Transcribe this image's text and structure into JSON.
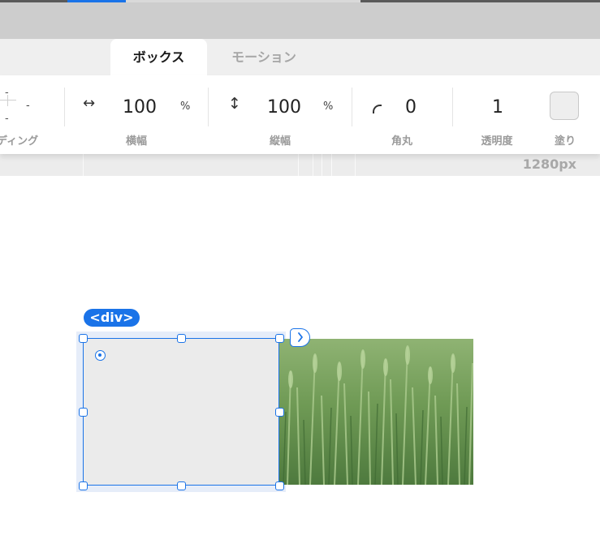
{
  "tabs": {
    "box": "ボックス",
    "motion": "モーション"
  },
  "panel": {
    "padding": {
      "label": "ディング",
      "top": "-",
      "right": "-",
      "bottom": "-"
    },
    "width": {
      "label": "横幅",
      "value": "100",
      "unit": "%",
      "icon": "horizontal-arrow-icon"
    },
    "height": {
      "label": "縦幅",
      "value": "100",
      "unit": "%",
      "icon": "vertical-arrow-icon"
    },
    "radius": {
      "label": "角丸",
      "value": "0",
      "icon": "corner-radius-icon"
    },
    "opacity": {
      "label": "透明度",
      "value": "1"
    },
    "fill": {
      "label": "塗り",
      "color": "#eeeeee"
    }
  },
  "ruler": {
    "size_label": "1280px"
  },
  "canvas": {
    "element_tag": "<div>"
  },
  "colors": {
    "accent": "#1a73e8",
    "selection_bg": "#e6edf9"
  }
}
